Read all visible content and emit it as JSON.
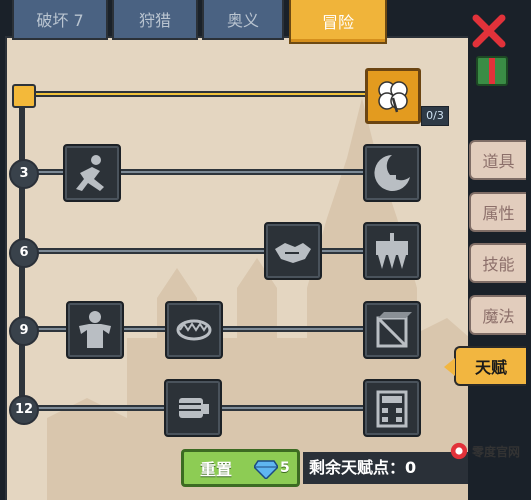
{
  "top_tabs": [
    {
      "label": "破坏 7",
      "active": false
    },
    {
      "label": "狩猎",
      "active": false
    },
    {
      "label": "奥义",
      "active": false
    },
    {
      "label": "冒险",
      "active": true
    }
  ],
  "side_tabs": [
    {
      "label": "道具",
      "active": false
    },
    {
      "label": "属性",
      "active": false
    },
    {
      "label": "技能",
      "active": false
    },
    {
      "label": "魔法",
      "active": false
    },
    {
      "label": "天赋",
      "active": true
    }
  ],
  "top_talent": {
    "icon": "clover-icon",
    "progress": "0/3"
  },
  "tiers": [
    {
      "rank": "3",
      "nodes": [
        "running-man-icon",
        "moon-potion-icon"
      ]
    },
    {
      "rank": "6",
      "nodes": [
        "handshake-icon",
        "spiked-banner-icon"
      ]
    },
    {
      "rank": "9",
      "nodes": [
        "muscle-hp-icon",
        "bear-trap-icon",
        "crate-icon"
      ]
    },
    {
      "rank": "12",
      "nodes": [
        "fist-icon",
        "calculator-icon"
      ]
    }
  ],
  "footer": {
    "reset_label": "重置",
    "gem_count": "5",
    "remaining_label": "剩余天赋点：0"
  },
  "watermark": {
    "text": "零度官网"
  },
  "colors": {
    "active_tab": "#f0b43a",
    "panel": "#e4d6c1",
    "node": "#2c3238",
    "reset": "#8dcc54",
    "close": "#e2323a"
  }
}
